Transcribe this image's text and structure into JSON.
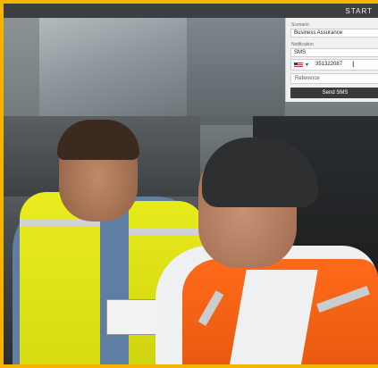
{
  "header": {
    "start_label": "START"
  },
  "form": {
    "scenario_label": "Scenario",
    "scenario_value": "Business Assurance",
    "notification_label": "Notification",
    "notification_value": "SMS",
    "phone_number": "351322087",
    "phone_flag_icon": "us-flag-icon",
    "reference_placeholder": "Reference",
    "send_button_label": "Send SMS"
  },
  "colors": {
    "frame": "#f4b400",
    "panel_bg": "#f0f0f0",
    "button_bg": "#3a3a3a",
    "vest_yellow": "#e9ec1e",
    "vest_orange": "#ff6a1a"
  }
}
